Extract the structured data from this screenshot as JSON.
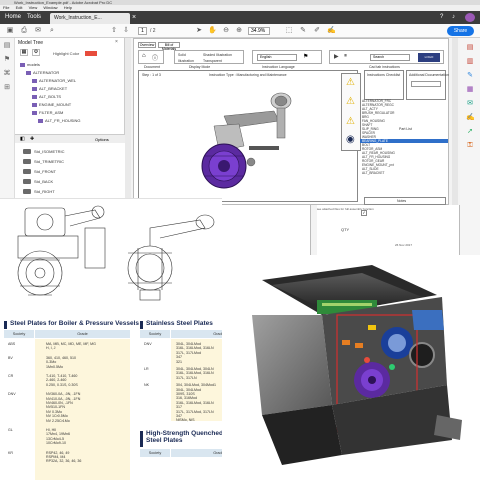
{
  "window": {
    "title": "Work_Instruction_Example.pdf - Adobe Acrobat Pro DC",
    "menu": [
      "File",
      "Edit",
      "View",
      "Window",
      "Help"
    ]
  },
  "tabs": {
    "home": "Home",
    "tools": "Tools",
    "doc": "Work_Instruction_E..."
  },
  "toolbar": {
    "page_current": "1",
    "page_total": "/ 2",
    "zoom": "34.9%",
    "share": "Share"
  },
  "model_tree": {
    "title": "Model Tree",
    "highlight": "Highlight Color",
    "nodes": [
      {
        "label": "models",
        "indent": 0
      },
      {
        "label": "ALTERNATOR",
        "indent": 1
      },
      {
        "label": "ALTERNATOR_WEL",
        "indent": 2
      },
      {
        "label": "ALT_BRACKET",
        "indent": 2
      },
      {
        "label": "ALT_BOLTS",
        "indent": 2
      },
      {
        "label": "ENGINE_MOUNT",
        "indent": 2
      },
      {
        "label": "FILTER_ASM",
        "indent": 2
      },
      {
        "label": "ALT_FR_HOUSING",
        "indent": 3
      }
    ],
    "views_label": "Options",
    "views": [
      "Std_ISOMETRIC",
      "Std_TRIMETRIC",
      "Std_FRONT",
      "Std_BACK",
      "Std_RIGHT"
    ]
  },
  "document": {
    "top_tabs": [
      "Overview",
      "Bill of Materials"
    ],
    "column_labels": [
      "Document",
      "Display Mode",
      "Instruction Language",
      "Cad tab instructions"
    ],
    "radio_labels": [
      "Solid",
      "Shaded Illustration",
      "Illustration",
      "Transparent"
    ],
    "language_value": "English",
    "step_label": "Step : 1 of 3",
    "instruction_type": "Instruction Type : Manufacturing and Maintenance",
    "sidebox_titles": [
      "Instructions Checklist",
      "Additional Documentation"
    ],
    "parts_title": "Part List",
    "parts": [
      "ALTERNATOR_FRC",
      "ALTERNATOR_REGC",
      "ALT_ACTY",
      "BRUSH_REGULATOR",
      "BRG",
      "FAN_HOUSING",
      "SHAFT",
      "SLIP_RING",
      "SPACER",
      "WASHER",
      "BEARING_PLATE",
      "BOLT",
      "ROTOR_ASM",
      "ALT_REAR_HOUSING",
      "ALT_FR_HOUSING",
      "ROTOR_GEAR",
      "ENGINE_MOUNT_pvt",
      "ALT_SLIDE",
      "ALT_BRACKET"
    ],
    "selected_part_index": 10,
    "notes_title": "Notes",
    "notes_text": "See attached files for full assembly function",
    "qty_label": "QTY",
    "date_text": "26 Nov 2017",
    "search_placeholder": "Search"
  },
  "plates": {
    "boiler": {
      "title": "Steel Plates for Boiler & Pressure Vessels",
      "headers": [
        "Society",
        "Grade"
      ],
      "rows": [
        {
          "society": "ABS",
          "grade": [
            "MA, MB, MC, MD, ME, MF, MG",
            "H, I, J"
          ]
        },
        {
          "society": "BV",
          "grade": [
            "360, 410, 460, 510",
            "0-3Mo",
            "1Mn0.5Mo"
          ]
        },
        {
          "society": "CR",
          "grade": [
            "T-410, T-410, T-460",
            "2-460, 2-460",
            "0.250, 0.31S, 0.30S"
          ]
        },
        {
          "society": "DNV",
          "grade": [
            "NV360-0A, -0N, -1FN",
            "NV410-0A, -0N, -1FN",
            "NV460-0N, -1FN",
            "NV510-1FN",
            "NV 0.3Mo",
            "NV 1Cr0.5Mo",
            "NV 2.25Cr1Mo"
          ]
        },
        {
          "society": "GL",
          "grade": [
            "HI, HII",
            "17Mn4, 19Mn6",
            "13CrMo4-5",
            "10CrMo9-10"
          ]
        },
        {
          "society": "KR",
          "grade": [
            "RSP42, 46, 49",
            "RSPM4, M4",
            "RP32A, 32, 36, 46, 36"
          ]
        }
      ]
    },
    "stainless": {
      "title": "Stainless Steel Plates",
      "headers": [
        "Society",
        "Grade"
      ],
      "rows": [
        {
          "society": "DNV",
          "grade": [
            "304L, 304LMod",
            "316L, 316LMod, 316LN",
            "317L, 317LMod",
            "347",
            "321"
          ]
        },
        {
          "society": "LR",
          "grade": [
            "304L, 304LMod, 304LN",
            "316L, 316LMod, 316LN",
            "317L, 317LN"
          ]
        },
        {
          "society": "NK",
          "grade": [
            "304, 304LMod, 304Mod1",
            "304L, 304LMod",
            "309S, 310S",
            "316, 316Mod",
            "316L, 316LMod, 316LN",
            "317",
            "317L, 317LMod, 317LN",
            "347",
            "NiSMo, NiS"
          ]
        }
      ]
    },
    "hs": {
      "title": "High-Strength Quenched & Tempered Steel Plates",
      "headers": [
        "Society",
        "Grade"
      ]
    }
  }
}
